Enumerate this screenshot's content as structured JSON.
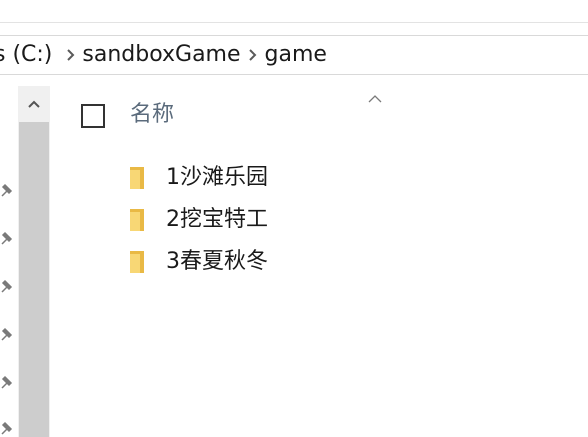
{
  "breadcrumb": {
    "items": [
      "s (C:)",
      "sandboxGame",
      "game"
    ]
  },
  "file_list": {
    "column_name": "名称",
    "items": [
      {
        "name": "1沙滩乐园",
        "icon": "folder-icon"
      },
      {
        "name": "2挖宝特工",
        "icon": "folder-icon"
      },
      {
        "name": "3春夏秋冬",
        "icon": "folder-icon"
      }
    ]
  },
  "colors": {
    "folder_yellow": "#f8d775",
    "folder_dark": "#e9b945",
    "column_header_text": "#5b6b7c",
    "scrollbar_thumb": "#cdcdcd",
    "scrollbar_track": "#f0f0f0"
  }
}
